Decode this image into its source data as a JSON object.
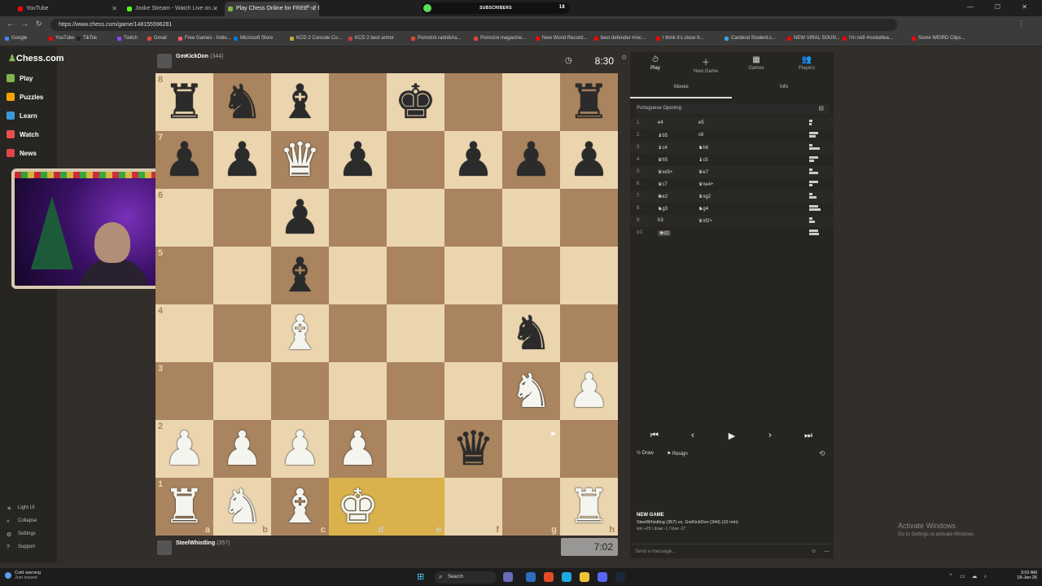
{
  "browser": {
    "tabs": [
      {
        "label": "YouTube",
        "color": "#ff0000",
        "active": false
      },
      {
        "label": "Joxke Stream - Watch Live on...",
        "color": "#53fc18",
        "active": false
      },
      {
        "label": "Play Chess Online for FREE - 2 Pl...",
        "color": "#81b64c",
        "active": true
      }
    ],
    "subscribers_label": "SUBSCRIBERS",
    "subscribers_count": "18",
    "window_controls": "— ☐ ✕",
    "url": "https://www.chess.com/game/148155596281",
    "bookmarks": [
      {
        "label": "Google",
        "color": "#4285f4"
      },
      {
        "label": "YouTube",
        "color": "#ff0000"
      },
      {
        "label": "TikTok",
        "color": "#222222"
      },
      {
        "label": "Twitch",
        "color": "#9146ff"
      },
      {
        "label": "Gmail",
        "color": "#ea4335"
      },
      {
        "label": "Free Games - Indie...",
        "color": "#fa5c5c"
      },
      {
        "label": "Microsoft Store",
        "color": "#0078d4"
      },
      {
        "label": "KCD 2 Console Co...",
        "color": "#c8a040"
      },
      {
        "label": "KCD 2 best armor",
        "color": "#c84040"
      },
      {
        "label": "Pomoćni radnik/ra...",
        "color": "#e0453a"
      },
      {
        "label": "Pomoćni magacine...",
        "color": "#e0453a"
      },
      {
        "label": "New World Record...",
        "color": "#ff0000"
      },
      {
        "label": "best defender #roc...",
        "color": "#ff0000"
      },
      {
        "label": "I think it's close fr...",
        "color": "#ff0000"
      },
      {
        "label": "Cardend Student.c...",
        "color": "#3aa0e0"
      },
      {
        "label": "NEW VIRAL SOUN...",
        "color": "#ff0000"
      },
      {
        "label": "I'm no9 #rocketlea...",
        "color": "#ff0000"
      },
      {
        "label": "Some WEIRD Clips...",
        "color": "#ff0000"
      }
    ]
  },
  "leftnav": {
    "logo": "Chess.com",
    "items": [
      {
        "label": "Play",
        "color": "#81b64c"
      },
      {
        "label": "Puzzles",
        "color": "#f7a400"
      },
      {
        "label": "Learn",
        "color": "#3a9ad9"
      },
      {
        "label": "Watch",
        "color": "#e94f4f"
      },
      {
        "label": "News",
        "color": "#e04848"
      }
    ],
    "footer": [
      {
        "label": "Light UI",
        "icon": "☀"
      },
      {
        "label": "Collapse",
        "icon": "«"
      },
      {
        "label": "Settings",
        "icon": "⚙"
      },
      {
        "label": "Support",
        "icon": "?"
      }
    ]
  },
  "players": {
    "top": {
      "name": "GmKickDon",
      "rating": "(344)",
      "clock": "8:30"
    },
    "bottom": {
      "name": "SteelWhistling",
      "rating": "(357)",
      "clock": "7:02"
    }
  },
  "board": {
    "files": [
      "a",
      "b",
      "c",
      "d",
      "e",
      "f",
      "g",
      "h"
    ],
    "ranks": [
      "8",
      "7",
      "6",
      "5",
      "4",
      "3",
      "2",
      "1"
    ],
    "highlight": [
      "d1",
      "e1"
    ],
    "pieces": {
      "a8": "bR",
      "b8": "bN",
      "c8": "bB",
      "e8": "bK",
      "h8": "bR",
      "a7": "bP",
      "b7": "bP",
      "c7": "wQ",
      "d7": "bP",
      "f7": "bP",
      "g7": "bP",
      "h7": "bP",
      "c6": "bP",
      "c5": "bB",
      "c4": "wB",
      "g4": "bN",
      "g3": "wN",
      "h3": "wP",
      "a2": "wP",
      "b2": "wP",
      "c2": "wP",
      "d2": "wP",
      "f2": "bQ",
      "a1": "wR",
      "b1": "wN",
      "c1": "wB",
      "d1": "wK",
      "h1": "wR"
    }
  },
  "panel": {
    "tabs": [
      {
        "label": "Play",
        "icon": "⏱"
      },
      {
        "label": "New Game",
        "icon": "＋"
      },
      {
        "label": "Games",
        "icon": "▦"
      },
      {
        "label": "Players",
        "icon": "👥"
      }
    ],
    "subtabs": [
      "Moves",
      "Info"
    ],
    "opening": "Portuguese Opening",
    "moves": [
      {
        "n": "1.",
        "w": "e4",
        "b": "e5"
      },
      {
        "n": "2.",
        "w": "♝b5",
        "b": "c6"
      },
      {
        "n": "3.",
        "w": "♝c4",
        "b": "♞h6"
      },
      {
        "n": "4.",
        "w": "♛h5",
        "b": "♝c5"
      },
      {
        "n": "5.",
        "w": "♛xe5+",
        "b": "♛e7"
      },
      {
        "n": "6.",
        "w": "♛c7",
        "b": "♛xe4+"
      },
      {
        "n": "7.",
        "w": "♚e2",
        "b": "♛xg2"
      },
      {
        "n": "8.",
        "w": "♞g3",
        "b": "♞g4"
      },
      {
        "n": "9.",
        "w": "h3",
        "b": "♛xf2+"
      },
      {
        "n": "10.",
        "w": "♚d1",
        "b": ""
      }
    ],
    "controls": [
      "⏮",
      "‹",
      "▶",
      "›",
      "⏭"
    ],
    "draw_label": "½ Draw",
    "resign_label": "⚑ Resign",
    "new_game_title": "NEW GAME",
    "new_game_detail": "SteelWhistling (357) vs. GmKickDon (344) (10 min)",
    "new_game_stats": "win +25 / draw -1 / lose -27",
    "chat_placeholder": "Send a message..."
  },
  "activate": {
    "title": "Activate Windows",
    "subtitle": "Go to Settings to activate Windows."
  },
  "taskbar": {
    "weather_title": "Cold warning",
    "weather_sub": "Just issued",
    "search_label": "Search",
    "time": "3:02 AM",
    "date": "18-Jan-26"
  }
}
